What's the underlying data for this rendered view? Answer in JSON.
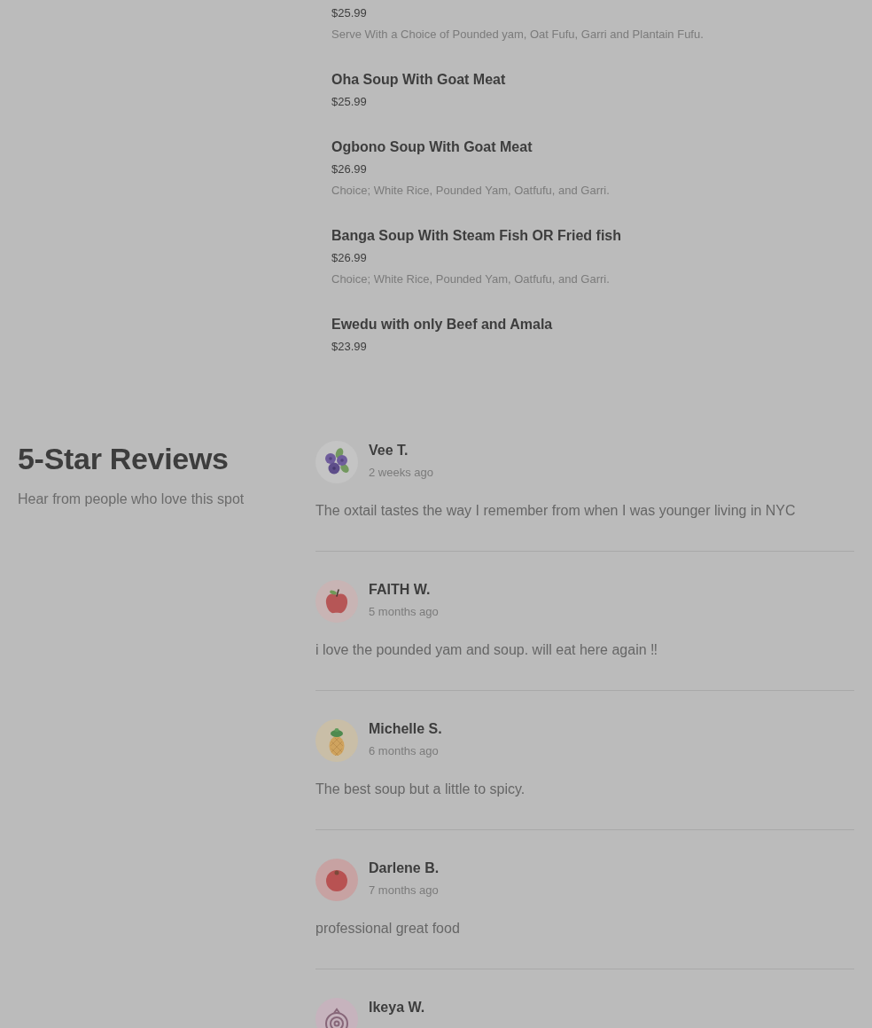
{
  "menu_items": [
    {
      "price": "$25.99",
      "description": "Serve With a Choice of Pounded yam, Oat Fufu, Garri and Plantain Fufu."
    },
    {
      "title": "Oha Soup With Goat Meat",
      "price": "$25.99"
    },
    {
      "title": "Ogbono Soup With Goat Meat",
      "price": "$26.99",
      "description": "Choice; White Rice, Pounded Yam, Oatfufu, and Garri."
    },
    {
      "title": "Banga Soup With Steam Fish OR Fried fish",
      "price": "$26.99",
      "description": "Choice; White Rice, Pounded Yam, Oatfufu, and Garri."
    },
    {
      "title": "Ewedu with only Beef and Amala",
      "price": "$23.99"
    }
  ],
  "reviews_section": {
    "title": "5-Star Reviews",
    "subtitle": "Hear from people who love this spot",
    "reviews": [
      {
        "kind": "blueberry",
        "name": "Vee T.",
        "time": "2 weeks ago",
        "text": "The oxtail tastes the way I remember from when I was younger living in NYC"
      },
      {
        "kind": "apple",
        "name": "FAITH W.",
        "time": "5 months ago",
        "text": "i love the pounded yam and soup. will eat here again ‼"
      },
      {
        "kind": "pineapple",
        "name": "Michelle S.",
        "time": "6 months ago",
        "text": "The best soup but a little to spicy."
      },
      {
        "kind": "tomato",
        "name": "Darlene B.",
        "time": "7 months ago",
        "text": "professional great food"
      },
      {
        "kind": "onion",
        "name": "Ikeya W."
      }
    ]
  }
}
